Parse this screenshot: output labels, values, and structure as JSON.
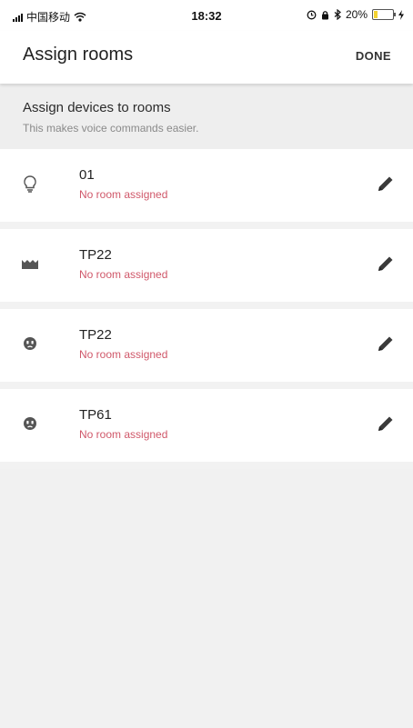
{
  "status_bar": {
    "carrier": "中国移动",
    "time": "18:32",
    "battery": "20%",
    "battery_level": 0.2
  },
  "app_bar": {
    "title": "Assign rooms",
    "done_label": "DONE"
  },
  "section": {
    "title": "Assign devices to rooms",
    "subtitle": "This makes voice commands easier."
  },
  "devices": [
    {
      "name": "01",
      "status": "No room assigned",
      "icon": "bulb-icon"
    },
    {
      "name": "TP22",
      "status": "No room assigned",
      "icon": "light-strip-icon"
    },
    {
      "name": "TP22",
      "status": "No room assigned",
      "icon": "plug-icon"
    },
    {
      "name": "TP61",
      "status": "No room assigned",
      "icon": "plug-icon"
    }
  ],
  "colors": {
    "status_pink": "#d0586a",
    "battery_yellow": "#f3d230",
    "icon_gray": "#555555"
  }
}
